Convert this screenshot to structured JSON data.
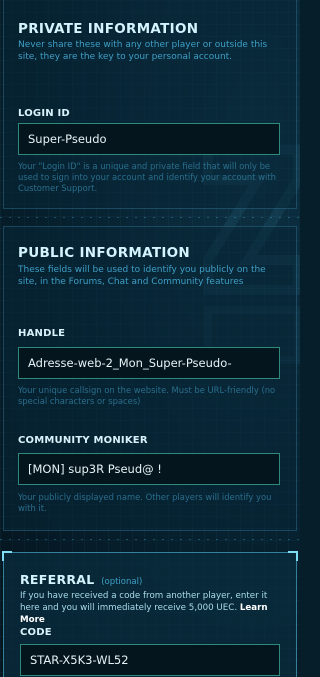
{
  "private_info": {
    "title": "PRIVATE INFORMATION",
    "description": "Never share these with any other player or outside this site, they are the key to your personal account.",
    "login_id": {
      "label": "LOGIN ID",
      "value": "Super-Pseudo",
      "help": "Your \"Login ID\" is a unique and private field that will only be used to sign into your account and identify your account with Customer Support."
    }
  },
  "public_info": {
    "title": "PUBLIC INFORMATION",
    "description": "These fields will be used to identify you publicly on the site, in the Forums, Chat and Community features",
    "handle": {
      "label": "HANDLE",
      "value": "Adresse-web-2_Mon_Super-Pseudo-",
      "help": "Your unique callsign on the website. Must be URL-friendly (no special characters or spaces)"
    },
    "community_moniker": {
      "label": "COMMUNITY MONIKER",
      "value": "[MON] sup3R Pseud@ !",
      "help": "Your publicly displayed name. Other players will identify you with it."
    }
  },
  "referral": {
    "title": "REFERRAL",
    "optional": "(optional)",
    "description": "If you have received a code from another player, enter it here and you will immediately receive 5,000 UEC.",
    "learn_more": "Learn More",
    "code": {
      "label": "CODE",
      "value": "STAR-X5K3-WL52"
    }
  },
  "colors": {
    "accent": "#d4f4ff",
    "input_border": "#2f8a7e",
    "muted_text": "#3f9fc6",
    "background": "#061d2a"
  }
}
